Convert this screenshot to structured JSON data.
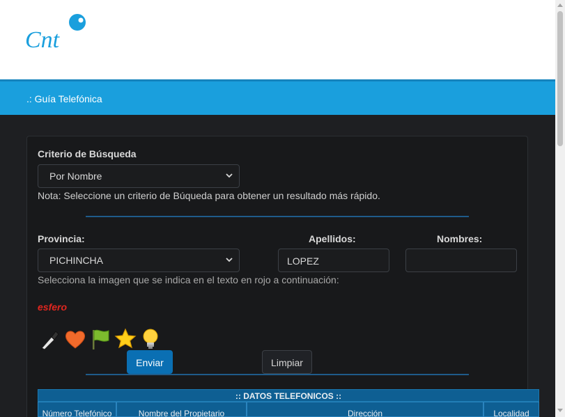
{
  "header": {
    "logo_text": "Cnt"
  },
  "nav": {
    "title": ".: Guía Telefónica"
  },
  "form": {
    "criterio_label": "Criterio de Búsqueda",
    "criterio_value": "Por Nombre",
    "nota": "Nota: Seleccione un criterio de Búqueda para obtener un resultado más rápido.",
    "provincia_label": "Provincia:",
    "provincia_value": "PICHINCHA",
    "apellidos_label": "Apellidos:",
    "apellidos_value": "LOPEZ",
    "nombres_label": "Nombres:",
    "nombres_value": "",
    "captcha_instruction": "Selecciona la imagen que se indica en el texto en rojo a continuación:",
    "captcha_word": "esfero",
    "captcha_icons": [
      "pen-icon",
      "heart-icon",
      "flag-icon",
      "star-icon",
      "lightbulb-icon"
    ],
    "submit_label": "Enviar",
    "clear_label": "Limpiar"
  },
  "results": {
    "title": ":: DATOS TELEFONICOS ::",
    "columns": [
      "Número Telefónico",
      "Nombre del Propietario",
      "Dirección",
      "Localidad"
    ]
  },
  "colors": {
    "accent": "#1a9fdd",
    "primary_button": "#0a6fb3",
    "captcha_text": "#e0261f"
  }
}
